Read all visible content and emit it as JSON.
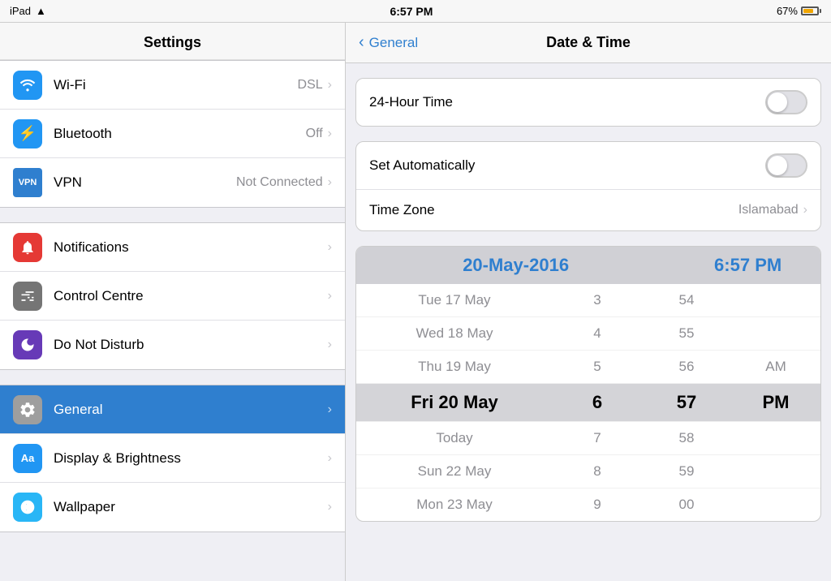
{
  "statusBar": {
    "left": "iPad",
    "wifi": "wifi",
    "center": "6:57 PM",
    "battery_pct": "67%"
  },
  "leftPanel": {
    "title": "Settings",
    "groups": [
      {
        "items": [
          {
            "id": "wifi",
            "icon": "wifi",
            "iconClass": "icon-wifi",
            "label": "Wi-Fi",
            "value": "DSL",
            "chevron": true
          },
          {
            "id": "bluetooth",
            "icon": "bluetooth",
            "iconClass": "icon-bluetooth",
            "label": "Bluetooth",
            "value": "Off",
            "chevron": true
          },
          {
            "id": "vpn",
            "icon": "vpn",
            "iconClass": "icon-vpn",
            "label": "VPN",
            "value": "Not Connected",
            "chevron": true
          }
        ]
      },
      {
        "items": [
          {
            "id": "notifications",
            "icon": "🔔",
            "iconClass": "icon-notifications",
            "label": "Notifications",
            "value": "",
            "chevron": true
          },
          {
            "id": "control",
            "icon": "⊞",
            "iconClass": "icon-control",
            "label": "Control Centre",
            "value": "",
            "chevron": true
          },
          {
            "id": "dnd",
            "icon": "🌙",
            "iconClass": "icon-dnd",
            "label": "Do Not Disturb",
            "value": "",
            "chevron": true
          }
        ]
      },
      {
        "items": [
          {
            "id": "general",
            "icon": "⚙",
            "iconClass": "icon-general",
            "label": "General",
            "value": "",
            "chevron": true,
            "active": true
          },
          {
            "id": "display",
            "icon": "Aa",
            "iconClass": "icon-display",
            "label": "Display & Brightness",
            "value": "",
            "chevron": true
          },
          {
            "id": "wallpaper",
            "icon": "✦",
            "iconClass": "icon-wallpaper",
            "label": "Wallpaper",
            "value": "",
            "chevron": true
          }
        ]
      }
    ]
  },
  "rightPanel": {
    "backLabel": "General",
    "title": "Date & Time",
    "rows": [
      {
        "id": "24hour",
        "label": "24-Hour Time",
        "toggle": false
      },
      {
        "id": "setauto",
        "label": "Set Automatically",
        "toggle": false
      },
      {
        "id": "timezone",
        "label": "Time Zone",
        "value": "Islamabad",
        "chevron": true
      }
    ],
    "pickerHeader": {
      "date": "20-May-2016",
      "hour": "6:57 PM"
    },
    "pickerRows": [
      {
        "date": "Tue 17 May",
        "h": "3",
        "m": "54",
        "ampm": "",
        "selected": false,
        "bold": false
      },
      {
        "date": "Wed 18 May",
        "h": "4",
        "m": "55",
        "ampm": "",
        "selected": false,
        "bold": false
      },
      {
        "date": "Thu 19 May",
        "h": "5",
        "m": "56",
        "ampm": "AM",
        "selected": false,
        "bold": false
      },
      {
        "date": "Fri 20 May",
        "h": "6",
        "m": "57",
        "ampm": "PM",
        "selected": false,
        "bold": true
      },
      {
        "date": "Today",
        "h": "7",
        "m": "58",
        "ampm": "",
        "selected": false,
        "bold": false
      },
      {
        "date": "Sun 22 May",
        "h": "8",
        "m": "59",
        "ampm": "",
        "selected": false,
        "bold": false
      },
      {
        "date": "Mon 23 May",
        "h": "9",
        "m": "00",
        "ampm": "",
        "selected": false,
        "bold": false
      }
    ]
  }
}
